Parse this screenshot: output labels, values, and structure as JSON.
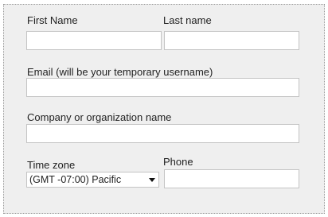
{
  "form": {
    "first_name": {
      "label": "First Name",
      "value": ""
    },
    "last_name": {
      "label": "Last name",
      "value": ""
    },
    "email": {
      "label": "Email (will be your temporary username)",
      "value": ""
    },
    "company": {
      "label": "Company or organization name",
      "value": ""
    },
    "time_zone": {
      "label": "Time zone",
      "selected": "(GMT -07:00) Pacific"
    },
    "phone": {
      "label": "Phone",
      "value": ""
    }
  }
}
